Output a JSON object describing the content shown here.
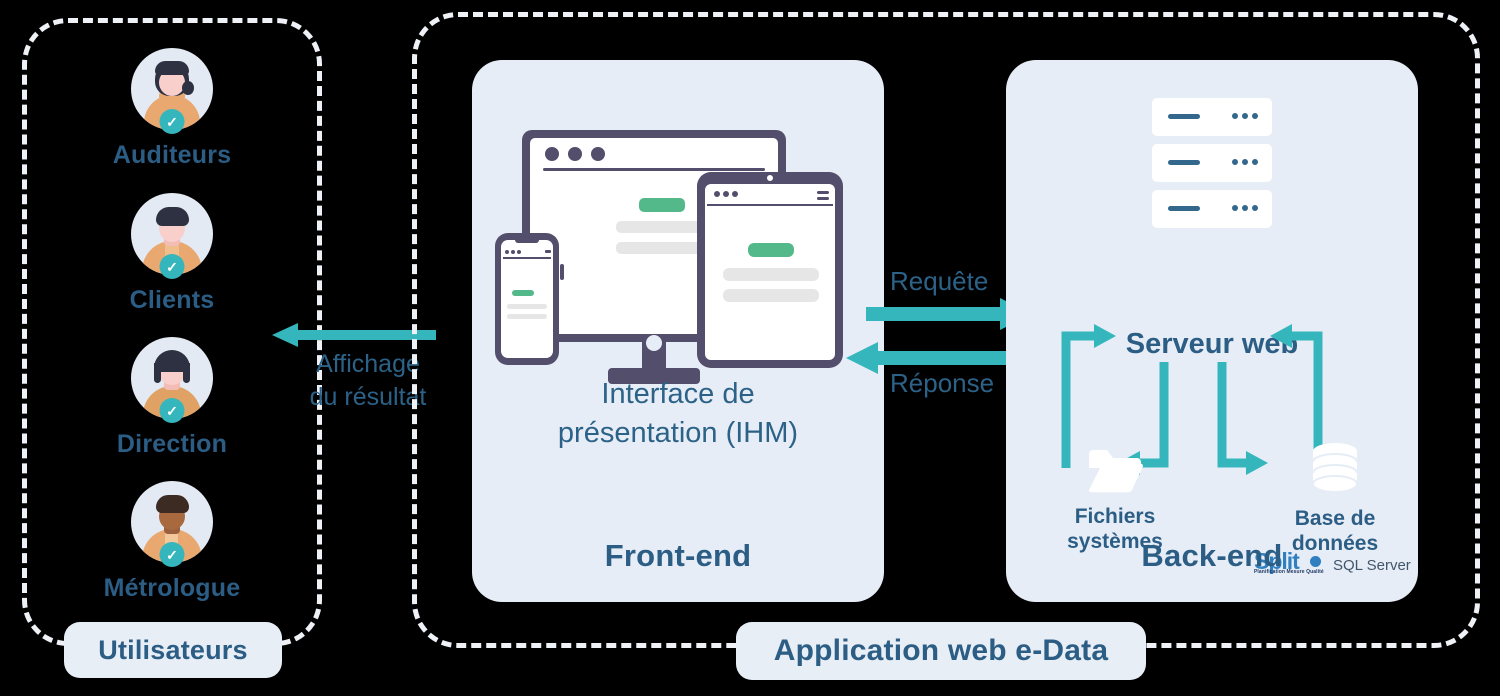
{
  "colors": {
    "background": "#000000",
    "dashed_border": "#eef1f6",
    "panel_bg": "#e6edf6",
    "pill_bg": "#e8eef6",
    "text_blue": "#2c5d85",
    "text_blue_light": "#2c6287",
    "accent_teal": "#35b6bd",
    "device_dark": "#524e6b",
    "device_green": "#54b98a",
    "device_gray": "#e6e6e6",
    "split_blue": "#2f7fc1"
  },
  "users_group": {
    "caption": "Utilisateurs",
    "items": [
      {
        "label": "Auditeurs",
        "avatar": "avatar-woman-dark-hair-orange-top",
        "badge": "check-badge"
      },
      {
        "label": "Clients",
        "avatar": "avatar-man-dark-hair-tan-top",
        "badge": "check-badge"
      },
      {
        "label": "Direction",
        "avatar": "avatar-woman-bob-hair-tan-top",
        "badge": "check-badge"
      },
      {
        "label": "Métrologue",
        "avatar": "avatar-man-brown-skin-tan-top",
        "badge": "check-badge"
      }
    ]
  },
  "display_flow": {
    "arrow": "arrow-left",
    "label_line1": "Affichage",
    "label_line2": "du résultat"
  },
  "app_group": {
    "caption": "Application web e-Data"
  },
  "front_panel": {
    "title_line1": "Interface de",
    "title_line2": "présentation (IHM)",
    "footer": "Front-end",
    "illustration": "responsive-devices-monitor-phone-tablet"
  },
  "exchange": {
    "request_label": "Requête",
    "request_arrow": "arrow-right",
    "response_label": "Réponse",
    "response_arrow": "arrow-left"
  },
  "back_panel": {
    "footer": "Back-end",
    "server_title": "Serveur web",
    "server_stack": {
      "icon": "server-rack-icon",
      "rows": [
        {
          "line": "status-line",
          "dots": "ellipsis"
        },
        {
          "line": "status-line",
          "dots": "ellipsis"
        },
        {
          "line": "status-line",
          "dots": "ellipsis"
        }
      ]
    },
    "nodes": [
      {
        "icon": "folder-icon",
        "label_line1": "Fichiers",
        "label_line2": "systèmes"
      },
      {
        "icon": "database-icon",
        "label_line1": "Base de",
        "label_line2": "données"
      }
    ],
    "connectors": [
      "arrow-up-right-to-server",
      "arrow-down-left-to-files",
      "arrow-down-right-to-database",
      "arrow-up-left-to-server"
    ],
    "logos": {
      "split_word": "Split",
      "split_tagline": "Planification Mesure Qualité",
      "sqlserver": "SQL Server"
    }
  }
}
